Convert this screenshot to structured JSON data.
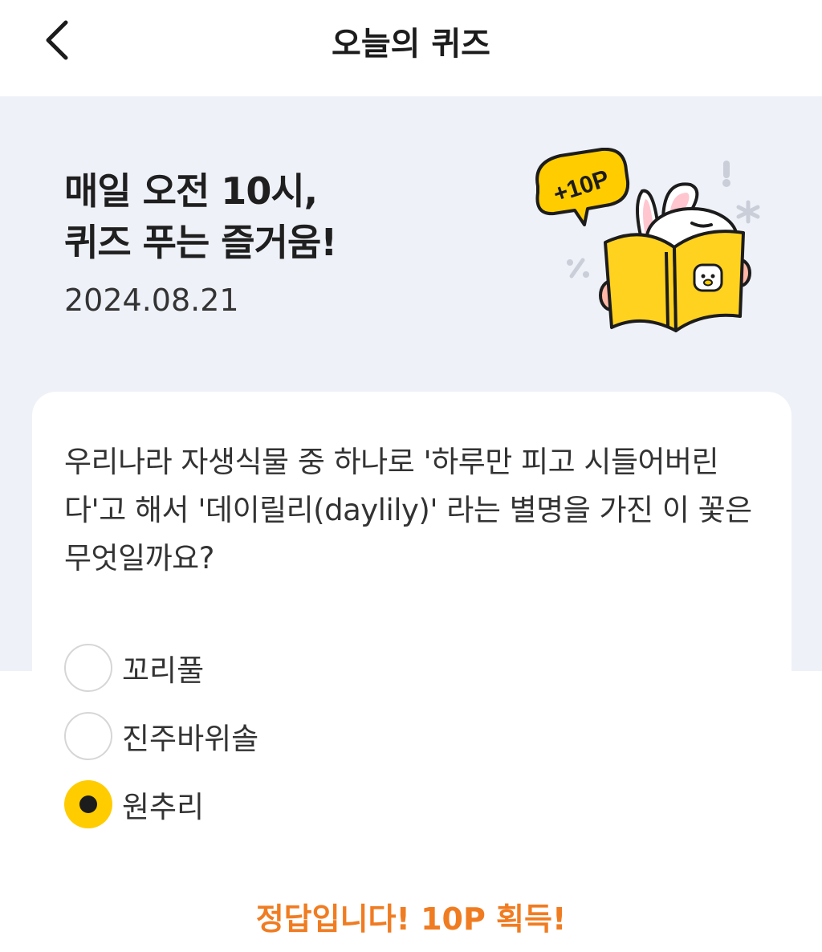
{
  "header": {
    "title": "오늘의 퀴즈",
    "back_icon": "chevron-left-icon"
  },
  "hero": {
    "title_line1": "매일 오전 10시,",
    "title_line2": "퀴즈 푸는 즐거움!",
    "date": "2024.08.21",
    "badge_text": "+10P",
    "colors": {
      "background": "#eef1f7",
      "accent": "#ffcc00",
      "book": "#ffd21f"
    }
  },
  "quiz": {
    "question": "우리나라 자생식물 중 하나로 '하루만 피고 시들어버린다'고 해서 '데이릴리(daylily)' 라는 별명을 가진 이 꽃은 무엇일까요?",
    "options": [
      {
        "label": "꼬리풀",
        "selected": false
      },
      {
        "label": "진주바위솔",
        "selected": false
      },
      {
        "label": "원추리",
        "selected": true
      }
    ]
  },
  "result": {
    "text": "정답입니다! 10P 획득!",
    "color": "#f07c22"
  }
}
